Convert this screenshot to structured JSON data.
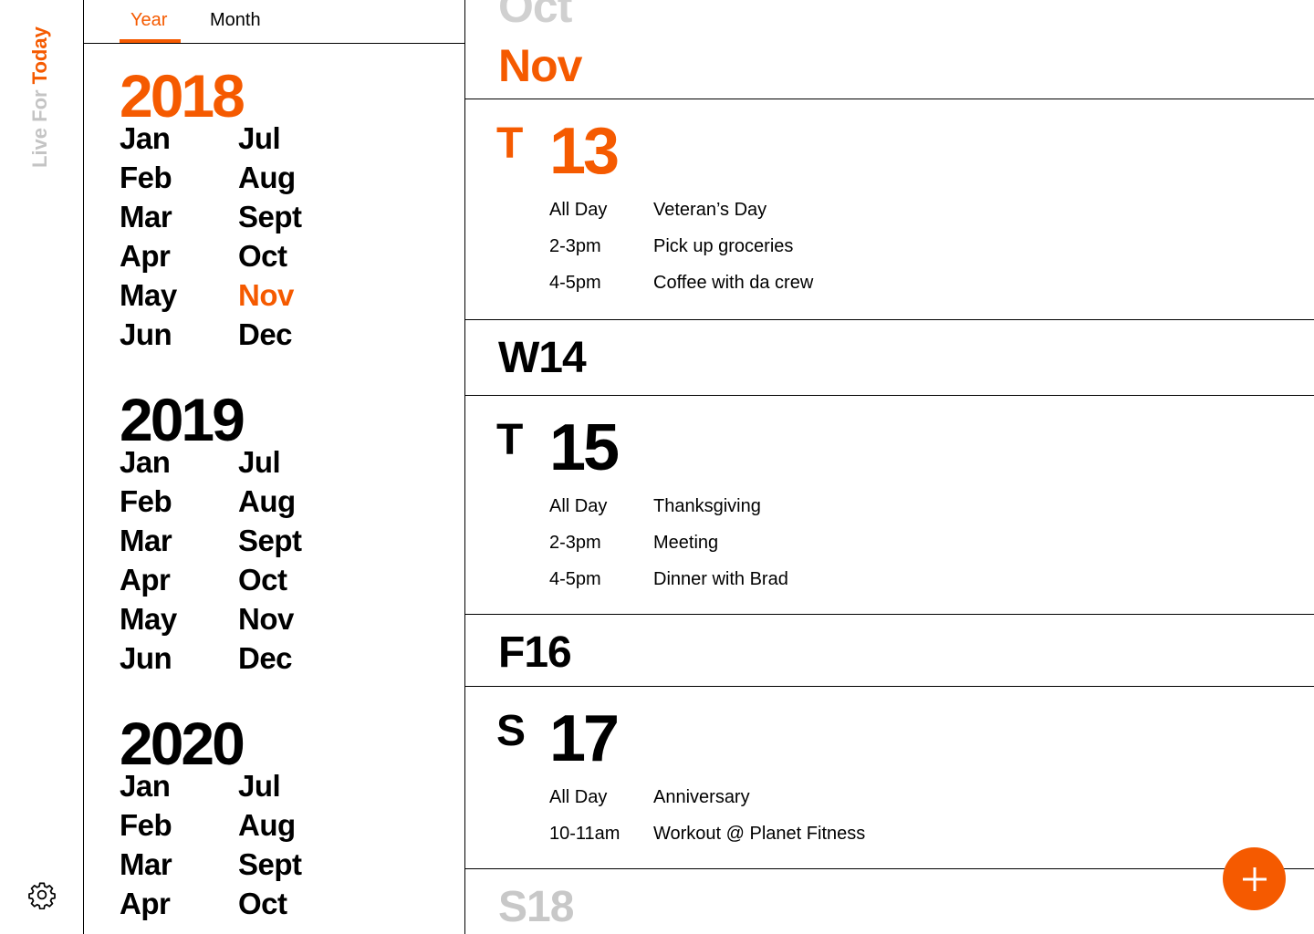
{
  "brand": {
    "prefix": "Live For ",
    "highlight": "Today"
  },
  "icons": {
    "settings": "gear-icon",
    "add": "plus-icon"
  },
  "colors": {
    "accent": "#f55a00",
    "muted": "#c4c4c4"
  },
  "tabs": [
    {
      "label": "Year",
      "active": true
    },
    {
      "label": "Month",
      "active": false
    }
  ],
  "years": [
    {
      "year": "2018",
      "highlight_year": true,
      "left": [
        "Jan",
        "Feb",
        "Mar",
        "Apr",
        "May",
        "Jun"
      ],
      "right": [
        "Jul",
        "Aug",
        "Sept",
        "Oct",
        "Nov",
        "Dec"
      ],
      "selected_month": "Nov"
    },
    {
      "year": "2019",
      "highlight_year": false,
      "left": [
        "Jan",
        "Feb",
        "Mar",
        "Apr",
        "May",
        "Jun"
      ],
      "right": [
        "Jul",
        "Aug",
        "Sept",
        "Oct",
        "Nov",
        "Dec"
      ]
    },
    {
      "year": "2020",
      "highlight_year": false,
      "left": [
        "Jan",
        "Feb",
        "Mar",
        "Apr"
      ],
      "right": [
        "Jul",
        "Aug",
        "Sept",
        "Oct"
      ]
    }
  ],
  "agenda": {
    "prev_month": "Oct",
    "current_month": "Nov",
    "days": [
      {
        "letter": "T",
        "number": "13",
        "highlight": true,
        "events": [
          {
            "time": "All Day",
            "title": "Veteran’s Day"
          },
          {
            "time": "2-3pm",
            "title": "Pick up groceries"
          },
          {
            "time": "4-5pm",
            "title": "Coffee with da crew"
          }
        ]
      },
      {
        "compact": "W14"
      },
      {
        "letter": "T",
        "number": "15",
        "highlight": false,
        "events": [
          {
            "time": "All Day",
            "title": "Thanksgiving"
          },
          {
            "time": "2-3pm",
            "title": "Meeting"
          },
          {
            "time": "4-5pm",
            "title": "Dinner with Brad"
          }
        ]
      },
      {
        "compact": "F16"
      },
      {
        "letter": "S",
        "number": "17",
        "highlight": false,
        "events": [
          {
            "time": "All Day",
            "title": "Anniversary"
          },
          {
            "time": "10-11am",
            "title": "Workout @ Planet Fitness"
          }
        ]
      },
      {
        "compact": "S18"
      }
    ]
  }
}
